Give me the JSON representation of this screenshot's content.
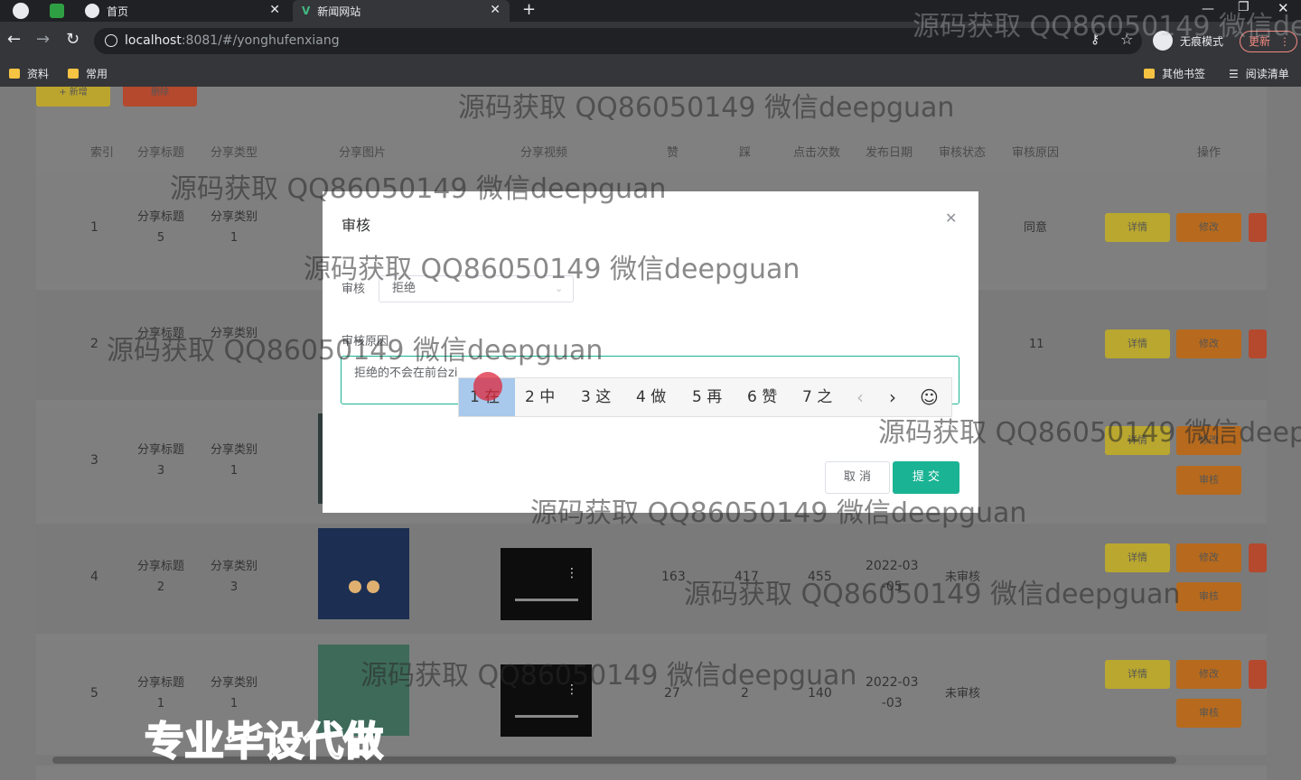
{
  "tabs": [
    {
      "label": "首页",
      "active": false
    },
    {
      "label": "新闻网站",
      "active": true
    }
  ],
  "new_tab_symbol": "+",
  "address": {
    "host": "localhost",
    "rest": ":8081/#/yonghufenxiang"
  },
  "incognito_label": "无痕模式",
  "update_label": "更新",
  "bookmarks": [
    "资料",
    "常用"
  ],
  "bookmarks_right": [
    "其他书签",
    "阅读清单"
  ],
  "toolbar": {
    "add_label": "+ 新增",
    "delete_label": "删除"
  },
  "table": {
    "headers": [
      "索引",
      "分享标题",
      "分享类型",
      "分享图片",
      "分享视频",
      "赞",
      "踩",
      "点击次数",
      "发布日期",
      "审核状态",
      "审核原因",
      "操作"
    ],
    "rows": [
      {
        "index": "1",
        "title": "分享标题\n5",
        "type": "分享类别\n1",
        "like": "",
        "dislike": "",
        "clicks": "",
        "date": "",
        "status": "",
        "reason": "同意",
        "detail": "详情",
        "edit": "修改",
        "audit": ""
      },
      {
        "index": "2",
        "title": "分享标题",
        "type": "分享类别",
        "like": "",
        "dislike": "",
        "clicks": "",
        "date": "",
        "status": "",
        "reason": "11",
        "detail": "详情",
        "edit": "修改",
        "audit": ""
      },
      {
        "index": "3",
        "title": "分享标题\n3",
        "type": "分享类别\n1",
        "like": "",
        "dislike": "",
        "clicks": "",
        "date": "",
        "status": "",
        "reason": "",
        "detail": "详情",
        "edit": "修改",
        "audit": "审核"
      },
      {
        "index": "4",
        "title": "分享标题\n2",
        "type": "分享类别\n3",
        "like": "163",
        "dislike": "417",
        "clicks": "455",
        "date": "2022-03\n-05",
        "status": "未审核",
        "reason": "",
        "detail": "详情",
        "edit": "修改",
        "audit": "审核"
      },
      {
        "index": "5",
        "title": "分享标题\n1",
        "type": "分享类别\n1",
        "like": "27",
        "dislike": "2",
        "clicks": "140",
        "date": "2022-03\n-03",
        "status": "未审核",
        "reason": "",
        "detail": "详情",
        "edit": "修改",
        "audit": "审核"
      }
    ]
  },
  "modal": {
    "title": "审核",
    "audit_label": "审核",
    "audit_value": "拒绝",
    "reason_label": "审核原因",
    "reason_value": "拒绝的不会在前台zi",
    "cancel_label": "取 消",
    "submit_label": "提 交"
  },
  "ime": {
    "candidates": [
      "1 在",
      "2 中",
      "3 这",
      "4 做",
      "5 再",
      "6 赞",
      "7 之"
    ],
    "prev": "‹",
    "next": "›",
    "emoji": "☺"
  },
  "watermark": "源码获取 QQ86050149 微信deepguan",
  "watermark_partial_1": "源码获取 QQ86050149 微信dee",
  "watermark_partial_2": "源码获取 QQ86050149 微信deep",
  "promo": "专业毕设代做",
  "colors": {
    "accent": "#1ab394",
    "detail": "#f4d13b",
    "edit": "#f08a1e",
    "delete": "#e8552f"
  }
}
